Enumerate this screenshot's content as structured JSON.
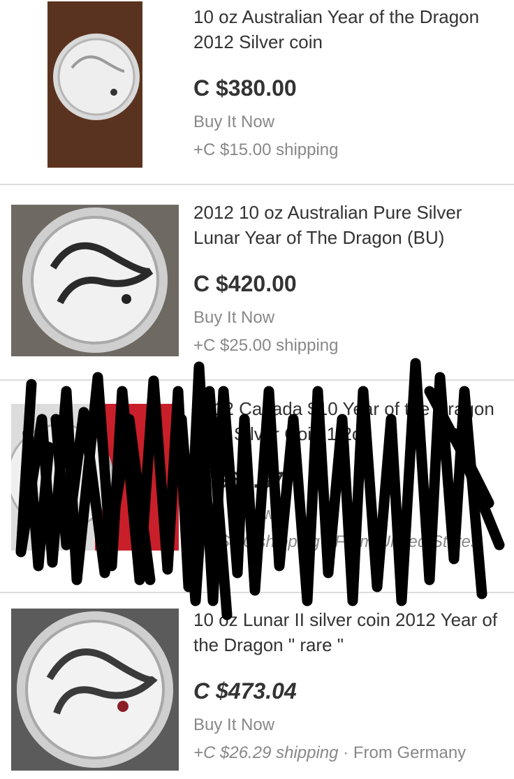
{
  "listings": [
    {
      "title": "10 oz Australian Year of the Dragon 2012 Silver coin",
      "price": "C $380.00",
      "format": "Buy It Now",
      "shipping": "+C $15.00 shipping",
      "origin": ""
    },
    {
      "title": "2012 10 oz Australian Pure Silver Lunar Year of The Dragon (BU)",
      "price": "C $420.00",
      "format": "Buy It Now",
      "shipping": "+C $25.00 shipping",
      "origin": ""
    },
    {
      "title": "2012 Canada $10 Year of the Dragon .999 Silver Coin 1/2oz",
      "price": "C $63.87",
      "format": "Buy It Now",
      "shipping": "+C $4.0 shipping · From United States",
      "origin": ""
    },
    {
      "title": "10 oz Lunar II silver coin 2012 Year of the Dragon \" rare \"",
      "price": "C $473.04",
      "format": "Buy It Now",
      "shipping": "+C $26.29 shipping",
      "origin": " · From Germany"
    }
  ],
  "colors": {
    "text": "#333333",
    "muted": "#888888",
    "divider": "#dcdcdc",
    "scribble": "#000000"
  },
  "icons": [
    "coin-photo",
    "coin-photo",
    "coin-photo",
    "coin-photo"
  ]
}
